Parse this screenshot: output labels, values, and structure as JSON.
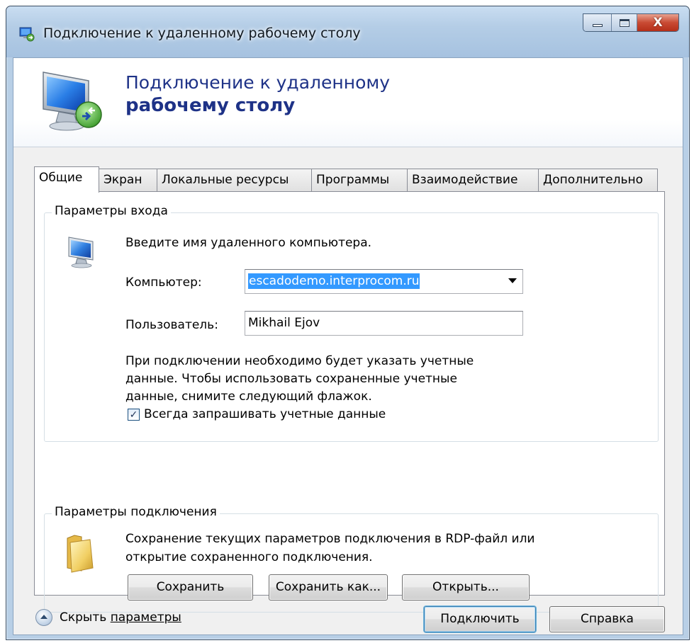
{
  "window": {
    "title": "Подключение к удаленному рабочему столу",
    "close_glyph": "X"
  },
  "banner": {
    "line1": "Подключение к удаленному",
    "line2": "рабочему столу"
  },
  "tabs": [
    {
      "label": "Общие",
      "active": true
    },
    {
      "label": "Экран",
      "active": false
    },
    {
      "label": "Локальные ресурсы",
      "active": false
    },
    {
      "label": "Программы",
      "active": false
    },
    {
      "label": "Взаимодействие",
      "active": false
    },
    {
      "label": "Дополнительно",
      "active": false
    }
  ],
  "login": {
    "legend": "Параметры входа",
    "instruction": "Введите имя удаленного компьютера.",
    "computer_label": "Компьютер:",
    "computer_value": "escadodemo.interprocom.ru",
    "user_label": "Пользователь:",
    "user_value": "Mikhail Ejov",
    "info_line1": "При подключении необходимо будет указать учетные",
    "info_line2": "данные. Чтобы использовать сохраненные учетные",
    "info_line3": "данные, снимите следующий флажок.",
    "always_ask_label": "Всегда запрашивать учетные данные",
    "always_ask_checked": true,
    "check_glyph": "✓"
  },
  "connection": {
    "legend": "Параметры подключения",
    "desc_line1": "Сохранение текущих параметров подключения в RDP-файл или",
    "desc_line2": "открытие сохраненного подключения.",
    "save_label": "Сохранить",
    "save_as_label": "Сохранить как...",
    "open_label": "Открыть..."
  },
  "footer": {
    "hide_options_prefix": "Скрыть ",
    "hide_options_underlined": "параметры",
    "connect_label": "Подключить",
    "help_label": "Справка"
  },
  "icons": {
    "title": "remote-desktop-icon",
    "banner": "monitor-connection-icon",
    "login": "computer-icon",
    "connection": "folder-icon",
    "toggle": "collapse-up-icon"
  },
  "colors": {
    "banner_text": "#1e3287",
    "selection": "#3399ff",
    "window_frame": "#b8cfe6"
  }
}
